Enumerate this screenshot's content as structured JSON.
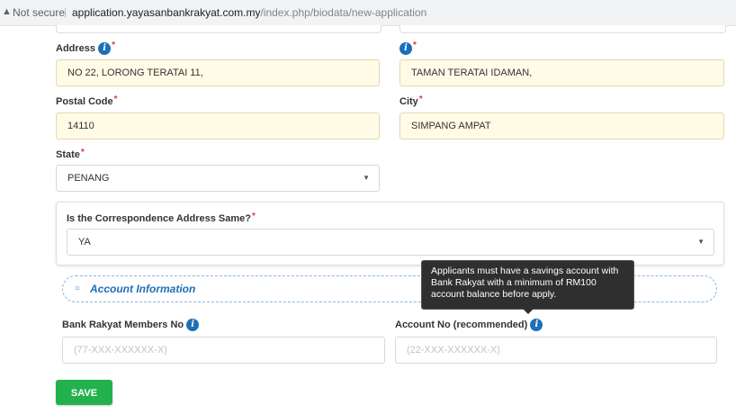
{
  "browser": {
    "security_label": "Not secure",
    "url_host": "application.yayasanbankrakyat.com.my",
    "url_path": "/index.php/biodata/new-application"
  },
  "form": {
    "address": {
      "label": "Address",
      "required_mark": "*",
      "line1": "NO 22, LORONG TERATAI 11,",
      "line2": "TAMAN TERATAI IDAMAN,"
    },
    "postal_code": {
      "label": "Postal Code",
      "required_mark": "*",
      "value": "14110"
    },
    "city": {
      "label": "City",
      "required_mark": "*",
      "value": "SIMPANG AMPAT"
    },
    "state": {
      "label": "State",
      "required_mark": "*",
      "value": "PENANG"
    },
    "correspondence": {
      "label": "Is the Correspondence Address Same?",
      "required_mark": "*",
      "value": "YA"
    },
    "account_section": {
      "title": "Account Information",
      "bullet": "○"
    },
    "members_no": {
      "label": "Bank Rakyat Members No",
      "placeholder": "(77-XXX-XXXXXX-X)"
    },
    "account_no": {
      "label": "Account No (recommended)",
      "placeholder": "(22-XXX-XXXXXX-X)"
    },
    "tooltip": "Applicants must have a savings account with Bank Rakyat with a minimum of RM100 account balance before apply.",
    "save_label": "SAVE"
  },
  "icons": {
    "info": "i",
    "caret": "▼",
    "warning": "▲"
  },
  "colors": {
    "accent_blue": "#1e6fb8",
    "save_green": "#22b14c",
    "required_red": "#e53935",
    "prefilled_bg": "#fffbe6"
  }
}
